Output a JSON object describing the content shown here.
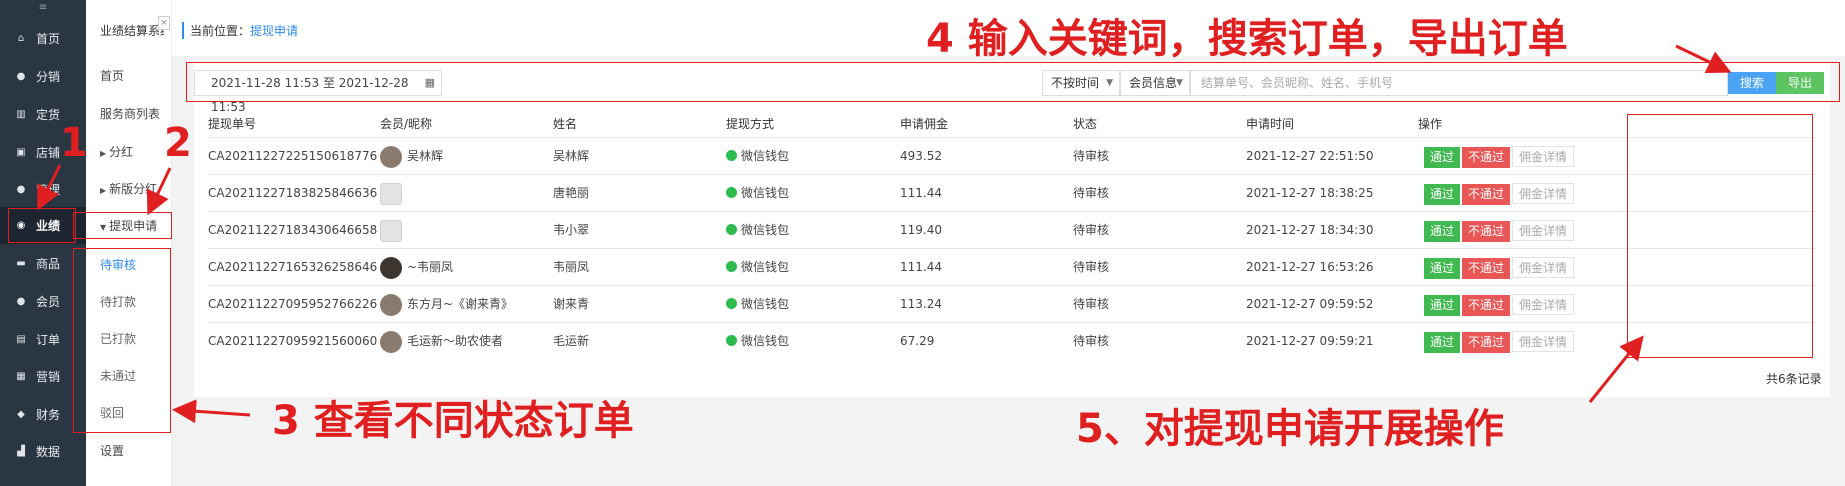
{
  "nav": {
    "top": "≡",
    "items": [
      {
        "label": "首页",
        "icon": "home-icon",
        "glyph": "⌂"
      },
      {
        "label": "分销",
        "icon": "user-icon",
        "glyph": "●"
      },
      {
        "label": "定货",
        "icon": "bar-chart-icon",
        "glyph": "▥"
      },
      {
        "label": "店铺",
        "icon": "shop-icon",
        "glyph": "▣"
      },
      {
        "label": "管理",
        "icon": "user-icon",
        "glyph": "●"
      },
      {
        "label": "业绩",
        "icon": "performance-icon",
        "glyph": "◉"
      },
      {
        "label": "商品",
        "icon": "goods-icon",
        "glyph": "▬"
      },
      {
        "label": "会员",
        "icon": "member-icon",
        "glyph": "●"
      },
      {
        "label": "订单",
        "icon": "order-icon",
        "glyph": "▤"
      },
      {
        "label": "营销",
        "icon": "marketing-icon",
        "glyph": "▦"
      },
      {
        "label": "财务",
        "icon": "finance-icon",
        "glyph": "◆"
      },
      {
        "label": "数据",
        "icon": "data-icon",
        "glyph": "▟"
      }
    ]
  },
  "subnav": {
    "title": "业绩结算系统",
    "close": "×",
    "items": [
      {
        "label": "首页"
      },
      {
        "label": "服务商列表"
      },
      {
        "label": "分红"
      },
      {
        "label": "新版分红"
      },
      {
        "label": "提现申请"
      }
    ],
    "status_items": [
      {
        "label": "待审核"
      },
      {
        "label": "待打款"
      },
      {
        "label": "已打款"
      },
      {
        "label": "未通过"
      },
      {
        "label": "驳回"
      }
    ],
    "settings": "设置"
  },
  "breadcrumb": {
    "prefix": "当前位置：",
    "current": "提现申请"
  },
  "filter": {
    "date_range": "2021-11-28 11:53 至 2021-12-28 11:53",
    "time_select": "不按时间",
    "member_select": "会员信息",
    "search_placeholder": "结算单号、会员昵称、姓名、手机号",
    "search_button": "搜索",
    "export_button": "导出"
  },
  "table": {
    "headers": [
      "提现单号",
      "会员/昵称",
      "姓名",
      "提现方式",
      "申请佣金",
      "状态",
      "申请时间",
      "操作"
    ],
    "rows": [
      {
        "id": "CA20211227225150618776",
        "member": "吴林辉",
        "name": "吴林辉",
        "method": "微信钱包",
        "amount": "493.52",
        "status": "待审核",
        "time": "2021-12-27 22:51:50",
        "avatar": "photo"
      },
      {
        "id": "CA20211227183825846636",
        "member": "",
        "name": "唐艳丽",
        "method": "微信钱包",
        "amount": "111.44",
        "status": "待审核",
        "time": "2021-12-27 18:38:25",
        "avatar": "placeholder"
      },
      {
        "id": "CA20211227183430646658",
        "member": "",
        "name": "韦小翠",
        "method": "微信钱包",
        "amount": "119.40",
        "status": "待审核",
        "time": "2021-12-27 18:34:30",
        "avatar": "placeholder"
      },
      {
        "id": "CA20211227165326258646",
        "member": "~韦丽凤",
        "name": "韦丽凤",
        "method": "微信钱包",
        "amount": "111.44",
        "status": "待审核",
        "time": "2021-12-27 16:53:26",
        "avatar": "dark"
      },
      {
        "id": "CA20211227095952766226",
        "member": "东方月~《谢来青》",
        "name": "谢来青",
        "method": "微信钱包",
        "amount": "113.24",
        "status": "待审核",
        "time": "2021-12-27 09:59:52",
        "avatar": "photo"
      },
      {
        "id": "CA20211227095921560060",
        "member": "毛运新～助农使者",
        "name": "毛运新",
        "method": "微信钱包",
        "amount": "67.29",
        "status": "待审核",
        "time": "2021-12-27 09:59:21",
        "avatar": "photo"
      }
    ],
    "actions": {
      "pass": "通过",
      "fail": "不通过",
      "detail": "佣金详情"
    },
    "total": "共6条记录"
  },
  "annotations": {
    "a1": "1",
    "a2": "2",
    "a3": "3 查看不同状态订单",
    "a4": "4 输入关键词，搜索订单，导出订单",
    "a5": "5、对提现申请开展操作"
  },
  "colors": {
    "accent": "#2d8cf0",
    "annotation": "#e02020",
    "pass": "#3fb950",
    "fail": "#e85656",
    "nav_bg": "#2b3643"
  }
}
